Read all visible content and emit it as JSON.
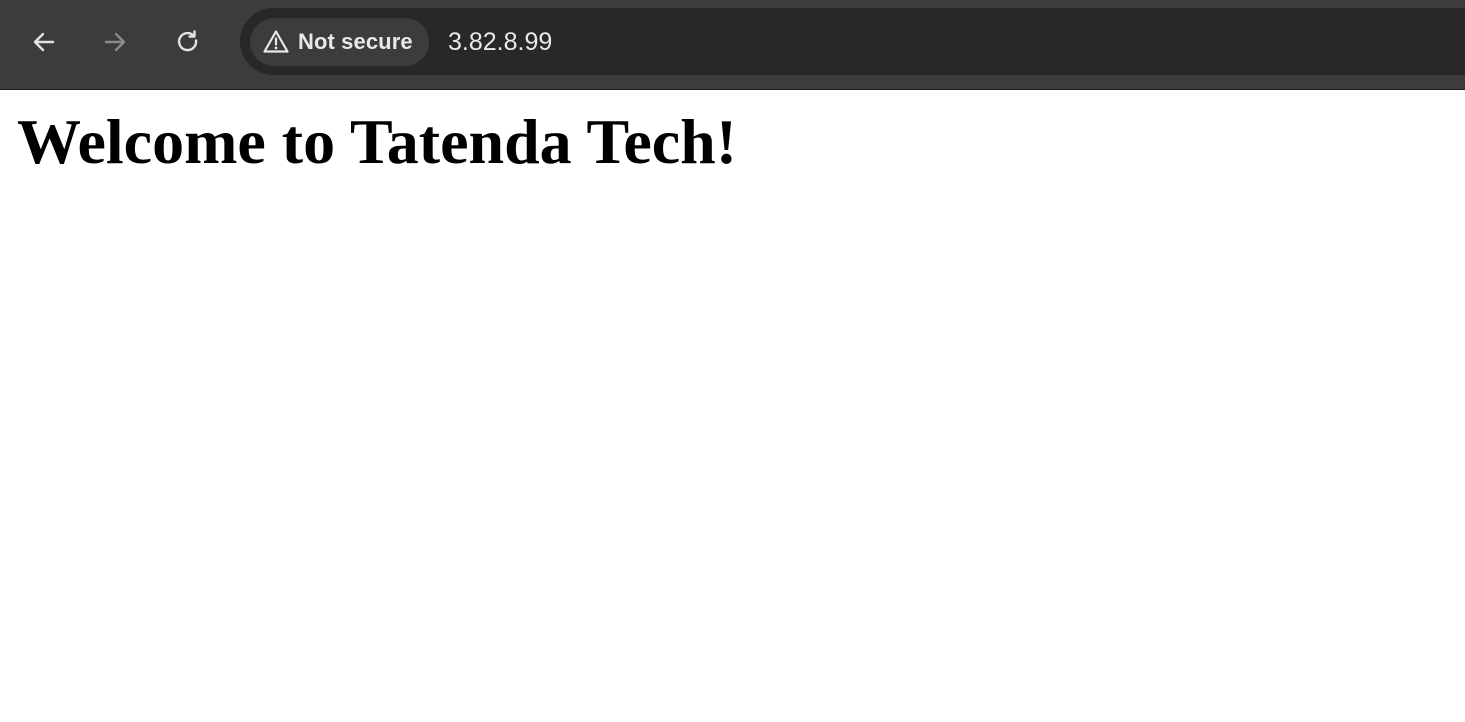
{
  "browser": {
    "nav": {
      "back_icon": "arrow-left-icon",
      "forward_icon": "arrow-right-icon",
      "reload_icon": "reload-icon"
    },
    "security_chip": {
      "icon": "warning-triangle-icon",
      "label": "Not secure"
    },
    "address": "3.82.8.99"
  },
  "page": {
    "heading": "Welcome to Tatenda Tech!"
  },
  "colors": {
    "toolbar_bg": "#3c3c3c",
    "omnibox_bg": "#282828",
    "chip_bg": "#3c3c3c",
    "toolbar_text": "#e8e8e8",
    "disabled_icon": "#8a8a8a",
    "page_bg": "#ffffff",
    "heading_text": "#000000"
  }
}
